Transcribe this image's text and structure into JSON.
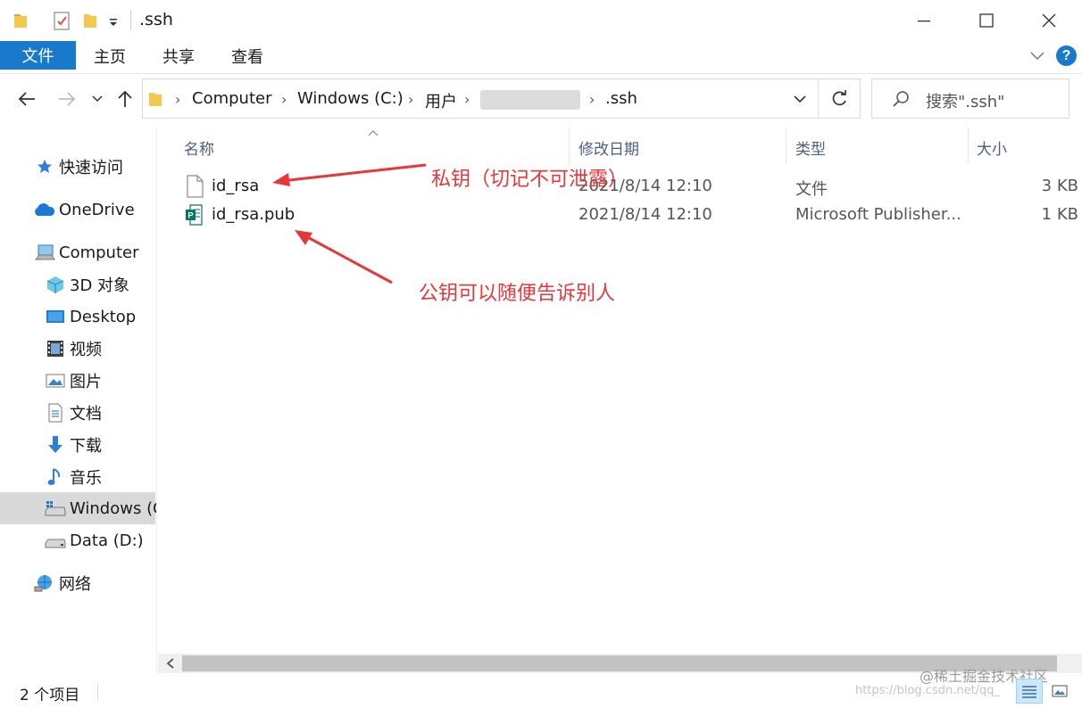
{
  "window": {
    "title": ".ssh",
    "minimize_icon": "minimize-icon",
    "maximize_icon": "maximize-icon",
    "close_icon": "close-icon"
  },
  "ribbon": {
    "tabs": [
      {
        "label": "文件",
        "active": true
      },
      {
        "label": "主页"
      },
      {
        "label": "共享"
      },
      {
        "label": "查看"
      }
    ],
    "help_label": "?"
  },
  "address": {
    "crumbs": [
      "Computer",
      "Windows (C:)",
      "用户",
      ".ssh"
    ],
    "search_placeholder": "搜索\".ssh\""
  },
  "sidebar": {
    "items": [
      {
        "label": "快速访问",
        "icon": "star-icon"
      },
      {
        "label": "OneDrive",
        "icon": "cloud-icon"
      },
      {
        "label": "Computer",
        "icon": "computer-icon"
      },
      {
        "label": "3D 对象",
        "icon": "cube-icon"
      },
      {
        "label": "Desktop",
        "icon": "desktop-icon"
      },
      {
        "label": "视频",
        "icon": "film-icon"
      },
      {
        "label": "图片",
        "icon": "picture-icon"
      },
      {
        "label": "文档",
        "icon": "document-icon"
      },
      {
        "label": "下载",
        "icon": "download-icon"
      },
      {
        "label": "音乐",
        "icon": "music-icon"
      },
      {
        "label": "Windows (C",
        "icon": "drive-c-icon",
        "selected": true
      },
      {
        "label": "Data (D:)",
        "icon": "drive-icon"
      },
      {
        "label": "网络",
        "icon": "network-icon"
      }
    ]
  },
  "columns": [
    "名称",
    "修改日期",
    "类型",
    "大小"
  ],
  "files": [
    {
      "name": "id_rsa",
      "date": "2021/8/14 12:10",
      "type": "文件",
      "size": "3 KB",
      "icon": "file-icon"
    },
    {
      "name": "id_rsa.pub",
      "date": "2021/8/14 12:10",
      "type": "Microsoft Publisher...",
      "size": "1 KB",
      "icon": "publisher-icon"
    }
  ],
  "annotations": {
    "private_key": "私钥（切记不可泄露）",
    "public_key": "公钥可以随便告诉别人",
    "color": "#e8363a"
  },
  "status": {
    "item_count": "2 个项目"
  },
  "watermark": {
    "line1": "@稀土掘金技术社区",
    "line2": "https://blog.csdn.net/qq_"
  },
  "colors": {
    "accent": "#1979ca",
    "selection": "#d9d9d9",
    "header_text": "#4d6082"
  }
}
